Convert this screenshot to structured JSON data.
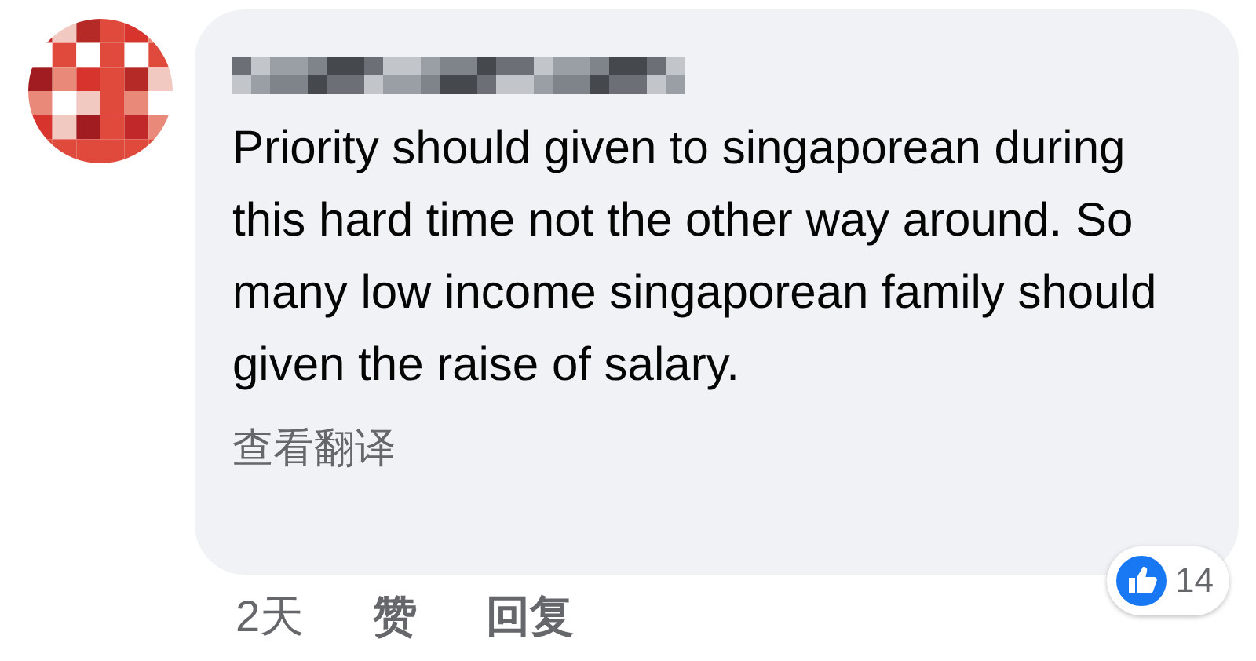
{
  "comment": {
    "text": "Priority should given to singaporean during this hard time not the other way around. So many low income singaporean family should given the raise of salary.",
    "translate_link": "查看翻译",
    "actions": [
      {
        "label": "2天",
        "kind": "time"
      },
      {
        "label": "赞",
        "kind": "action"
      },
      {
        "label": "回复",
        "kind": "action"
      }
    ],
    "reactions": {
      "count": "14"
    }
  }
}
